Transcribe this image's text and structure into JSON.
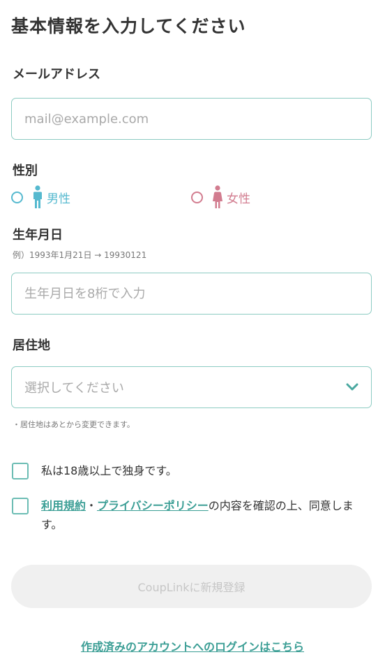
{
  "header": {
    "title": "基本情報を入力してください"
  },
  "email": {
    "label": "メールアドレス",
    "placeholder": "mail@example.com",
    "value": ""
  },
  "gender": {
    "label": "性別",
    "options": [
      {
        "label": "男性",
        "color": "#55b9cf",
        "icon": "male-person-icon"
      },
      {
        "label": "女性",
        "color": "#d27c8f",
        "icon": "female-person-icon"
      }
    ]
  },
  "birthdate": {
    "label": "生年月日",
    "example": "例）1993年1月21日 → 19930121",
    "placeholder": "生年月日を8桁で入力",
    "value": ""
  },
  "residence": {
    "label": "居住地",
    "selected": "選択してください",
    "note": "・居住地はあとから変更できます。"
  },
  "agreements": {
    "age_check": "私は18歳以上で独身です。",
    "terms_link": "利用規約",
    "separator": "・",
    "privacy_link": "プライバシーポリシー",
    "terms_suffix": "の内容を確認の上、同意します。"
  },
  "submit": {
    "label": "CoupLinkに新規登録"
  },
  "footer": {
    "login_link": "作成済みのアカウントへのログインはこちら"
  },
  "colors": {
    "accent": "#3b9e95",
    "border": "#8ccbc2",
    "male": "#55b9cf",
    "female": "#d27c8f"
  }
}
